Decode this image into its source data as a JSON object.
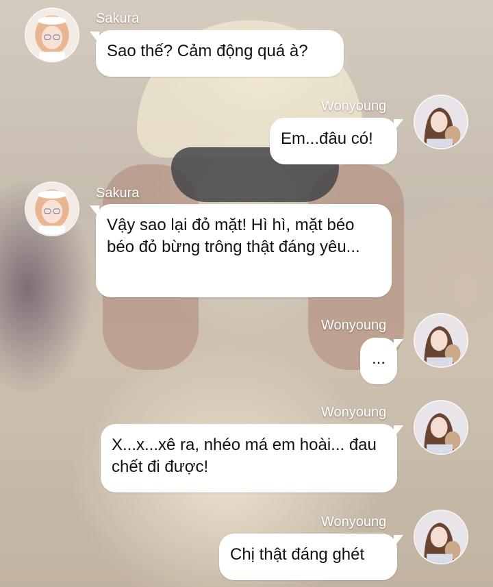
{
  "chat": {
    "messages": [
      {
        "sender": "Sakura",
        "side": "left",
        "text": "Sao thế? Cảm động quá à?"
      },
      {
        "sender": "Wonyoung",
        "side": "right",
        "text": "Em...đâu có!"
      },
      {
        "sender": "Sakura",
        "side": "left",
        "text": "Vậy sao lại đỏ mặt! Hì hì, mặt béo béo đỏ bừng trông thật đáng yêu..."
      },
      {
        "sender": "Wonyoung",
        "side": "right",
        "text": "..."
      },
      {
        "sender": "Wonyoung",
        "side": "right",
        "text": "X...x...xê ra, nhéo má em hoài... đau chết đi được!"
      },
      {
        "sender": "Wonyoung",
        "side": "right",
        "text": "Chị thật đáng ghét"
      }
    ]
  },
  "colors": {
    "bubble": "#ffffff",
    "name_text": "#ffffff",
    "bubble_text": "#111111"
  }
}
